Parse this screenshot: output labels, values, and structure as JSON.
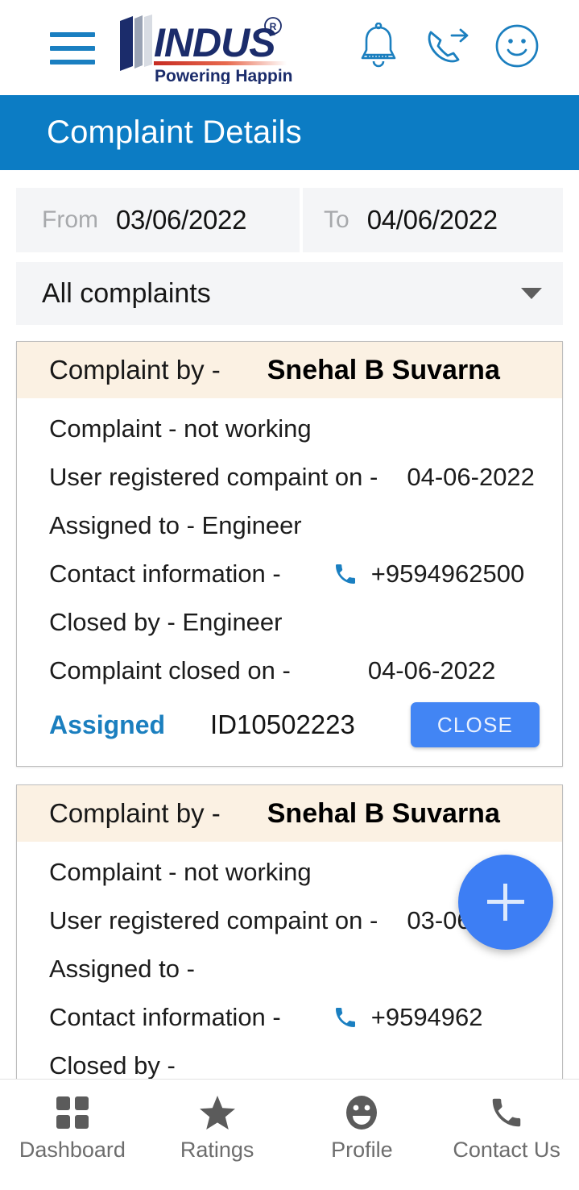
{
  "header": {
    "menu_icon": "hamburger-menu-icon",
    "logo": {
      "brand": "INDUS",
      "registered_mark": "®",
      "tagline": "Powering Happiness"
    },
    "icons": [
      {
        "name": "notification-bell-icon",
        "label": "Notifications"
      },
      {
        "name": "call-forward-icon",
        "label": "Call"
      },
      {
        "name": "smiley-face-icon",
        "label": "Feedback"
      }
    ]
  },
  "page": {
    "title": "Complaint Details",
    "title_bar_color": "#0C7CC4"
  },
  "filters": {
    "from_label": "From",
    "from_value": "03/06/2022",
    "to_label": "To",
    "to_value": "04/06/2022",
    "complaint_filter_value": "All complaints",
    "complaint_filter_options": [
      "All complaints"
    ],
    "field_bg_color": "#F4F5F7"
  },
  "complaints": [
    {
      "by_label": "Complaint by -",
      "by_name": "Snehal B Suvarna",
      "complaint_label": "Complaint - not working",
      "registered_label": "User registered compaint on -",
      "registered_date": "04-06-2022",
      "assigned_label": "Assigned to - Engineer",
      "contact_label": "Contact information -",
      "contact_number": "+9594962500",
      "closed_by_label": "Closed by - Engineer",
      "closed_on_label": "Complaint closed on -",
      "closed_on_date": "04-06-2022",
      "status": "Assigned",
      "id": "ID10502223",
      "action_label": "CLOSE"
    },
    {
      "by_label": "Complaint by -",
      "by_name": "Snehal B Suvarna",
      "complaint_label": "Complaint - not working",
      "registered_label": "User registered compaint on -",
      "registered_date": "03-06-2022",
      "assigned_label": "Assigned to -",
      "contact_label": "Contact information -",
      "contact_number": "+9594962",
      "closed_by_label": "Closed by -"
    }
  ],
  "fab": {
    "name": "add-complaint-button",
    "icon": "plus-icon",
    "color": "#3D7EF4"
  },
  "bottom_nav": [
    {
      "label": "Dashboard",
      "icon": "grid-icon"
    },
    {
      "label": "Ratings",
      "icon": "star-icon"
    },
    {
      "label": "Profile",
      "icon": "smiley-face-icon"
    },
    {
      "label": "Contact Us",
      "icon": "phone-icon"
    }
  ],
  "colors": {
    "accent_blue": "#0C7CC4",
    "icon_blue": "#1B7FBF",
    "button_blue": "#4285F4",
    "card_head_cream": "#FBF1E3",
    "logo_navy": "#15276B",
    "logo_red": "#D02B20"
  }
}
